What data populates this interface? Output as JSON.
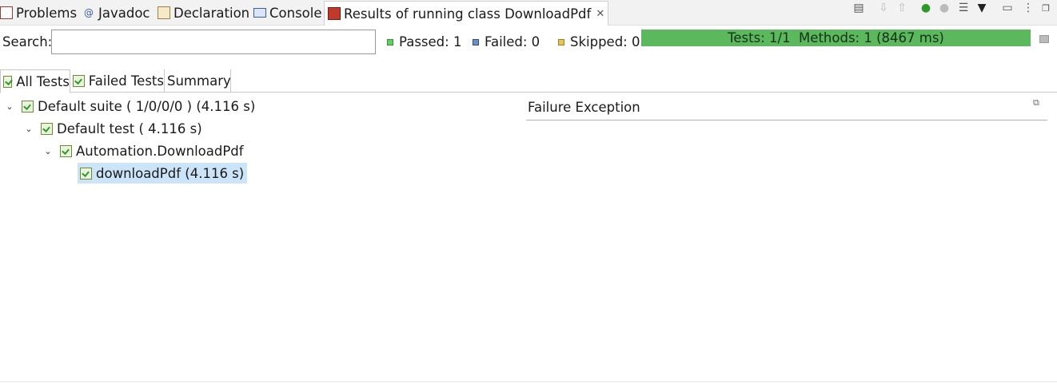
{
  "tabs": [
    {
      "label": "Problems",
      "icon": "problems-icon"
    },
    {
      "label": "Javadoc",
      "icon": "javadoc-icon"
    },
    {
      "label": "Declaration",
      "icon": "declaration-icon"
    },
    {
      "label": "Console",
      "icon": "console-icon"
    },
    {
      "label": "Results of running class DownloadPdf",
      "icon": "testng-icon",
      "active": true
    }
  ],
  "search": {
    "label": "Search:",
    "value": ""
  },
  "stats": {
    "passed": "Passed: 1",
    "failed": "Failed: 0",
    "skipped": "Skipped: 0"
  },
  "progress": {
    "text": "Tests: 1/1  Methods: 1 (8467 ms)",
    "fraction": 1.0,
    "color": "#5cb85c"
  },
  "subtabs": [
    "All Tests",
    "Failed Tests",
    "Summary"
  ],
  "tree": [
    {
      "label": "Default suite ( 1/0/0/0 ) (4.116 s)"
    },
    {
      "label": "Default test ( 4.116 s)"
    },
    {
      "label": "Automation.DownloadPdf"
    },
    {
      "label": "downloadPdf  (4.116 s)",
      "selected": true
    }
  ],
  "failure": {
    "title": "Failure Exception"
  },
  "colors": {
    "selection": "#cce4f7",
    "passed": "#2b9a2b"
  }
}
